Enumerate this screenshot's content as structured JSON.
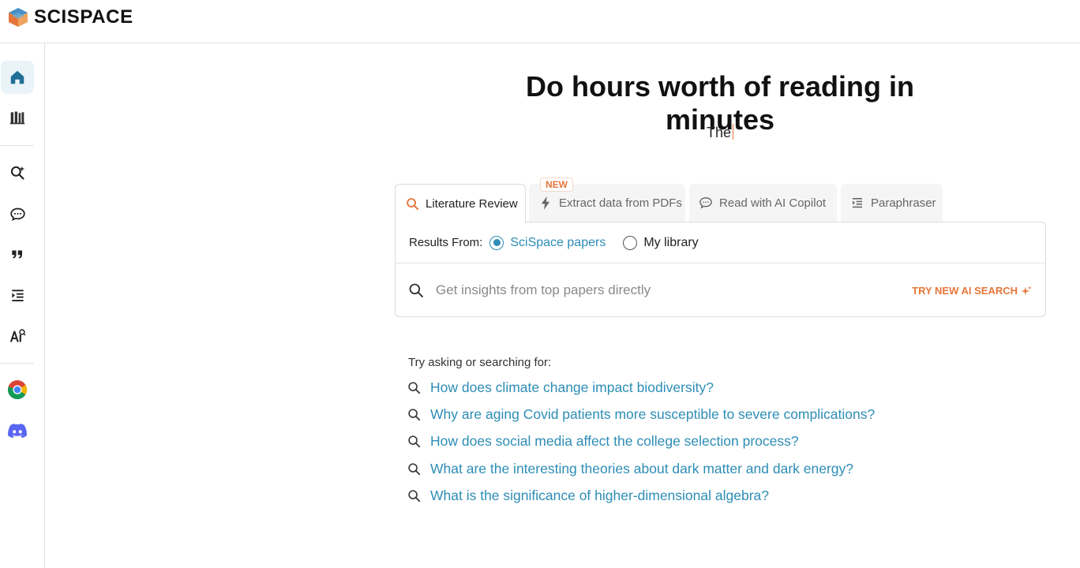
{
  "brand": {
    "name": "SCISPACE"
  },
  "sidebar": {
    "items": [
      {
        "icon": "home-icon",
        "active": true
      },
      {
        "icon": "library-icon",
        "active": false
      },
      {
        "icon": "literature-search-icon",
        "active": false
      },
      {
        "icon": "chat-icon",
        "active": false
      },
      {
        "icon": "citation-quote-icon",
        "active": false
      },
      {
        "icon": "paraphrase-icon",
        "active": false
      },
      {
        "icon": "ai-detector-icon",
        "active": false
      },
      {
        "icon": "chrome-extension-icon",
        "active": false
      },
      {
        "icon": "discord-icon",
        "active": false
      }
    ]
  },
  "main": {
    "headline": "Do hours worth of reading in minutes",
    "typing_text": "The",
    "tabs": [
      {
        "label": "Literature Review",
        "icon": "search-icon",
        "active": true
      },
      {
        "label": "Extract data from PDFs",
        "icon": "bolt-icon",
        "badge": "NEW",
        "active": false
      },
      {
        "label": "Read with AI Copilot",
        "icon": "chat-icon",
        "active": false
      },
      {
        "label": "Paraphraser",
        "icon": "paraphrase-icon",
        "active": false
      }
    ],
    "results_from": {
      "label": "Results From:",
      "options": [
        {
          "label": "SciSpace papers",
          "selected": true
        },
        {
          "label": "My library",
          "selected": false
        }
      ]
    },
    "search": {
      "placeholder": "Get insights from top papers directly",
      "value": "",
      "try_ai": "TRY NEW AI SEARCH"
    },
    "suggestions_label": "Try asking or searching for:",
    "suggestions": [
      "How does climate change impact biodiversity?",
      "Why are aging Covid patients more susceptible to severe complications?",
      "How does social media affect the college selection process?",
      "What are the interesting theories about dark matter and dark energy?",
      "What is the significance of higher-dimensional algebra?"
    ]
  },
  "colors": {
    "accent_blue": "#2d8db5",
    "accent_orange": "#e5763a",
    "border": "#dcdcdc"
  }
}
